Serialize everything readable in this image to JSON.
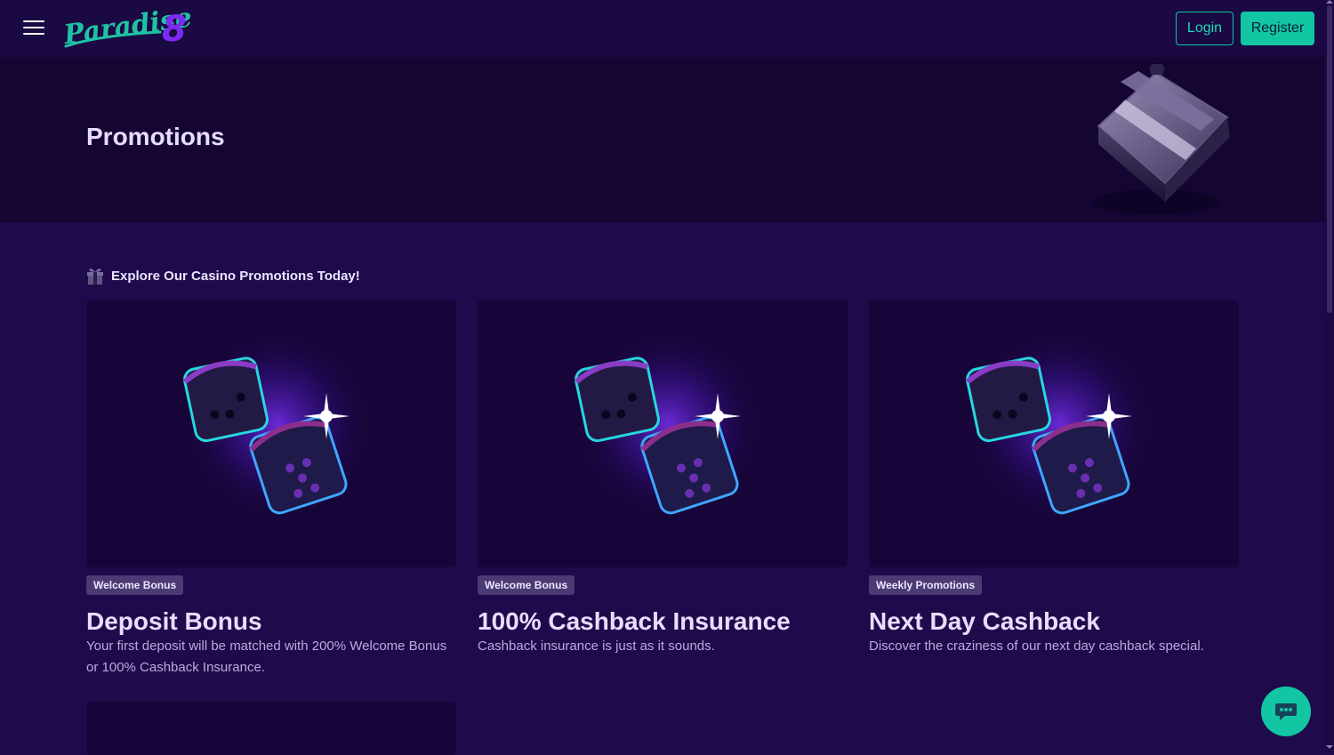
{
  "header": {
    "logo_text": "Paradise8",
    "login_label": "Login",
    "register_label": "Register",
    "menu_icon": "hamburger-menu-icon"
  },
  "hero": {
    "title": "Promotions",
    "art": "gift-box-icon"
  },
  "section": {
    "icon": "gift-icon",
    "title": "Explore Our Casino Promotions Today!"
  },
  "promotions": [
    {
      "tag": "Welcome Bonus",
      "title": "Deposit Bonus",
      "description": "Your first deposit will be matched with 200% Welcome Bonus or 100% Cashback Insurance.",
      "image": "dice-image"
    },
    {
      "tag": "Welcome Bonus",
      "title": "100% Cashback Insurance",
      "description": "Cashback insurance is just as it sounds.",
      "image": "dice-image"
    },
    {
      "tag": "Weekly Promotions",
      "title": "Next Day Cashback",
      "description": "Discover the craziness of our next day cashback special.",
      "image": "dice-image"
    }
  ],
  "chat": {
    "icon": "chat-bubble-icon"
  },
  "colors": {
    "background": "#1f0b4b",
    "header": "#1a0943",
    "hero": "#150533",
    "accent": "#12c6a4",
    "tag": "#4b3a73"
  }
}
